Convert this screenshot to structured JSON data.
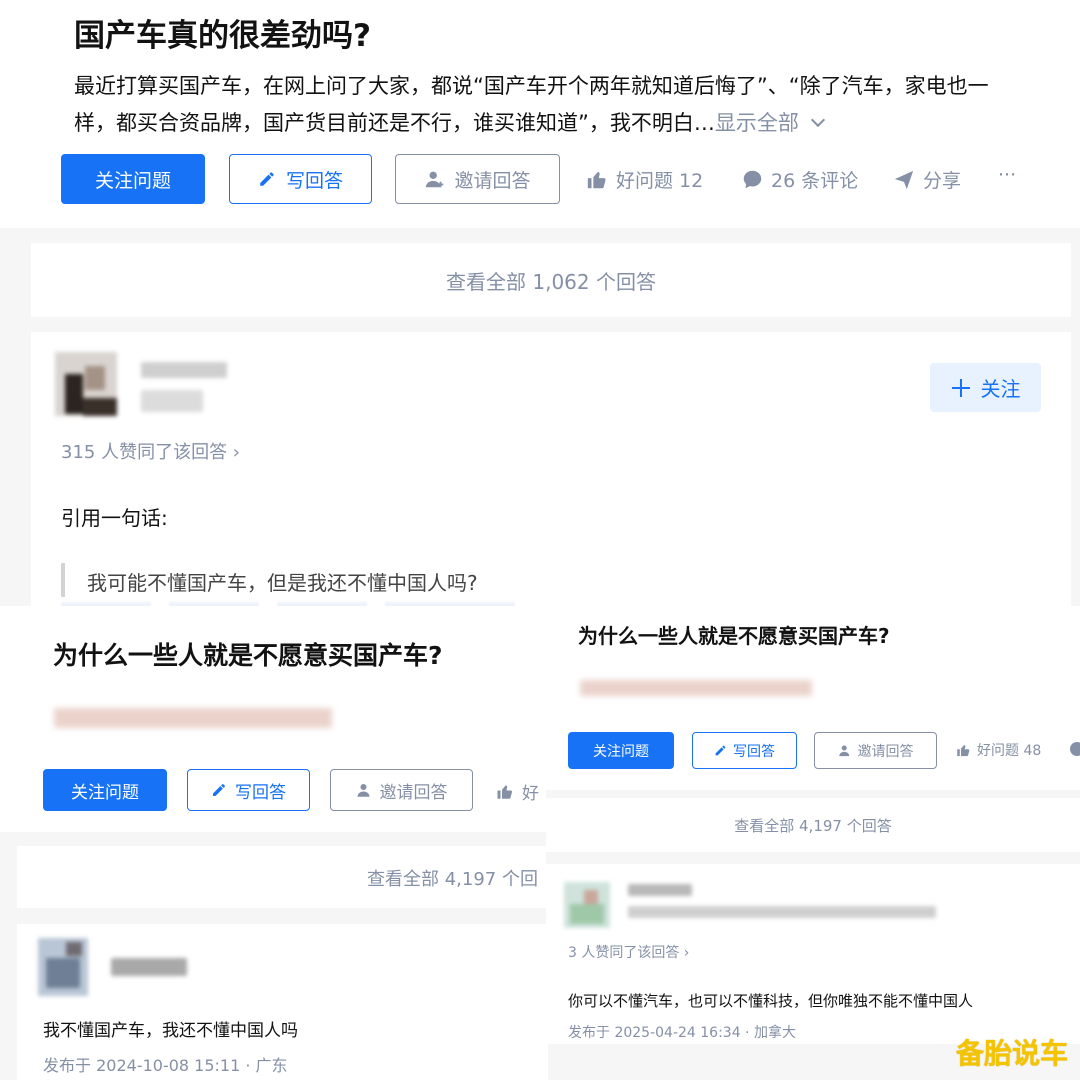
{
  "panel1": {
    "title": "国产车真的很差劲吗?",
    "desc_line1": "最近打算买国产车，在网上问了大家，都说“国产车开个两年就知道后悔了”、“除了汽车，家电也一",
    "desc_line2": "样，都买合资品牌，国产货目前还是不行，谁买谁知道”，我不明白…",
    "show_all": "显示全部",
    "follow_question": "关注问题",
    "write_answer": "写回答",
    "invite_answer": "邀请回答",
    "good_question": "好问题 12",
    "comments": "26 条评论",
    "share": "分享",
    "more": "···",
    "view_all": "查看全部 1,062 个回答",
    "follow": "关注",
    "liked": "315 人赞同了该回答 ›",
    "answer_intro": "引用一句话:",
    "answer_quote": "我可能不懂国产车，但是我还不懂中国人吗?"
  },
  "panel2": {
    "title": "为什么一些人就是不愿意买国产车?",
    "follow_question": "关注问题",
    "write_answer": "写回答",
    "invite_answer": "邀请回答",
    "good_question_partial": "好",
    "view_all": "查看全部 4,197 个回",
    "answer_text": "我不懂国产车，我还不懂中国人吗",
    "published": "发布于 2024-10-08 15:11 · 广东"
  },
  "panel3": {
    "title": "为什么一些人就是不愿意买国产车?",
    "follow_question": "关注问题",
    "write_answer": "写回答",
    "invite_answer": "邀请回答",
    "good_question": "好问题 48",
    "view_all": "查看全部 4,197 个回答",
    "liked": "3 人赞同了该回答 ›",
    "answer_text": "你可以不懂汽车，也可以不懂科技，但你唯独不能不懂中国人",
    "published": "发布于 2025-04-24 16:34 · 加拿大"
  },
  "watermark": "备胎说车",
  "colors": {
    "accent": "#1772f6",
    "muted": "#8590a6",
    "watermark": "#f5c400"
  }
}
